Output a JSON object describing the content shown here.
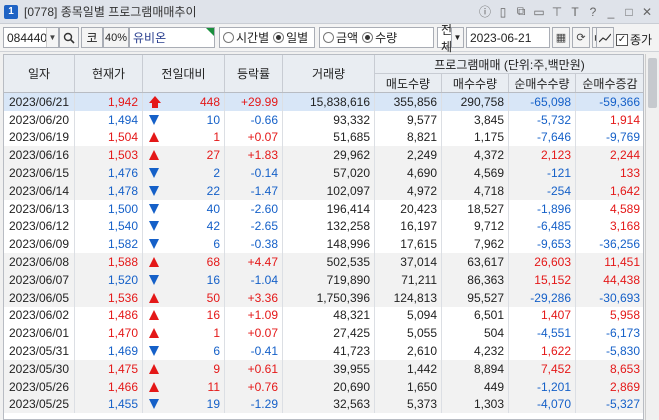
{
  "window": {
    "number": "1",
    "title": "[0778] 종목일별 프로그램매매추이"
  },
  "toolbar": {
    "code": "084440",
    "ko_label": "코",
    "pct_label": "40%",
    "stock_name": "유비온",
    "radio_time": "시간별",
    "radio_daily": "일별",
    "radio_amount": "금액",
    "radio_qty": "수량",
    "select_all": "전체",
    "date": "2023-06-21",
    "check_label": "종가"
  },
  "columns": {
    "date": "일자",
    "price": "현재가",
    "change": "전일대비",
    "rate": "등락률",
    "volume": "거래량",
    "group": "프로그램매매 (단위:주,백만원)",
    "sell": "매도수량",
    "buy": "매수수량",
    "net": "순매수수량",
    "net_inc": "순매수증감"
  },
  "rows": [
    {
      "date": "2023/06/21",
      "price": "1,942",
      "dir": "limit",
      "chg": "448",
      "rate": "+29.99",
      "vol": "15,838,616",
      "sell": "355,856",
      "buy": "290,758",
      "net": "-65,098",
      "inc": "-59,366"
    },
    {
      "date": "2023/06/20",
      "price": "1,494",
      "dir": "dn",
      "chg": "10",
      "rate": "-0.66",
      "vol": "93,332",
      "sell": "9,577",
      "buy": "3,845",
      "net": "-5,732",
      "inc": "1,914"
    },
    {
      "date": "2023/06/19",
      "price": "1,504",
      "dir": "up",
      "chg": "1",
      "rate": "+0.07",
      "vol": "51,685",
      "sell": "8,821",
      "buy": "1,175",
      "net": "-7,646",
      "inc": "-9,769"
    },
    {
      "date": "2023/06/16",
      "price": "1,503",
      "dir": "up",
      "chg": "27",
      "rate": "+1.83",
      "vol": "29,962",
      "sell": "2,249",
      "buy": "4,372",
      "net": "2,123",
      "inc": "2,244"
    },
    {
      "date": "2023/06/15",
      "price": "1,476",
      "dir": "dn",
      "chg": "2",
      "rate": "-0.14",
      "vol": "57,020",
      "sell": "4,690",
      "buy": "4,569",
      "net": "-121",
      "inc": "133"
    },
    {
      "date": "2023/06/14",
      "price": "1,478",
      "dir": "dn",
      "chg": "22",
      "rate": "-1.47",
      "vol": "102,097",
      "sell": "4,972",
      "buy": "4,718",
      "net": "-254",
      "inc": "1,642"
    },
    {
      "date": "2023/06/13",
      "price": "1,500",
      "dir": "dn",
      "chg": "40",
      "rate": "-2.60",
      "vol": "196,414",
      "sell": "20,423",
      "buy": "18,527",
      "net": "-1,896",
      "inc": "4,589"
    },
    {
      "date": "2023/06/12",
      "price": "1,540",
      "dir": "dn",
      "chg": "42",
      "rate": "-2.65",
      "vol": "132,258",
      "sell": "16,197",
      "buy": "9,712",
      "net": "-6,485",
      "inc": "3,168"
    },
    {
      "date": "2023/06/09",
      "price": "1,582",
      "dir": "dn",
      "chg": "6",
      "rate": "-0.38",
      "vol": "148,996",
      "sell": "17,615",
      "buy": "7,962",
      "net": "-9,653",
      "inc": "-36,256"
    },
    {
      "date": "2023/06/08",
      "price": "1,588",
      "dir": "up",
      "chg": "68",
      "rate": "+4.47",
      "vol": "502,535",
      "sell": "37,014",
      "buy": "63,617",
      "net": "26,603",
      "inc": "11,451"
    },
    {
      "date": "2023/06/07",
      "price": "1,520",
      "dir": "dn",
      "chg": "16",
      "rate": "-1.04",
      "vol": "719,890",
      "sell": "71,211",
      "buy": "86,363",
      "net": "15,152",
      "inc": "44,438"
    },
    {
      "date": "2023/06/05",
      "price": "1,536",
      "dir": "up",
      "chg": "50",
      "rate": "+3.36",
      "vol": "1,750,396",
      "sell": "124,813",
      "buy": "95,527",
      "net": "-29,286",
      "inc": "-30,693"
    },
    {
      "date": "2023/06/02",
      "price": "1,486",
      "dir": "up",
      "chg": "16",
      "rate": "+1.09",
      "vol": "48,321",
      "sell": "5,094",
      "buy": "6,501",
      "net": "1,407",
      "inc": "5,958"
    },
    {
      "date": "2023/06/01",
      "price": "1,470",
      "dir": "up",
      "chg": "1",
      "rate": "+0.07",
      "vol": "27,425",
      "sell": "5,055",
      "buy": "504",
      "net": "-4,551",
      "inc": "-6,173"
    },
    {
      "date": "2023/05/31",
      "price": "1,469",
      "dir": "dn",
      "chg": "6",
      "rate": "-0.41",
      "vol": "41,723",
      "sell": "2,610",
      "buy": "4,232",
      "net": "1,622",
      "inc": "-5,830"
    },
    {
      "date": "2023/05/30",
      "price": "1,475",
      "dir": "up",
      "chg": "9",
      "rate": "+0.61",
      "vol": "39,955",
      "sell": "1,442",
      "buy": "8,894",
      "net": "7,452",
      "inc": "8,653"
    },
    {
      "date": "2023/05/26",
      "price": "1,466",
      "dir": "up",
      "chg": "11",
      "rate": "+0.76",
      "vol": "20,690",
      "sell": "1,650",
      "buy": "449",
      "net": "-1,201",
      "inc": "2,869"
    },
    {
      "date": "2023/05/25",
      "price": "1,455",
      "dir": "dn",
      "chg": "19",
      "rate": "-1.29",
      "vol": "32,563",
      "sell": "5,373",
      "buy": "1,303",
      "net": "-4,070",
      "inc": "-5,327"
    }
  ],
  "colors": {
    "up": "#e41818",
    "down": "#1560c8",
    "selected_row": "#d8e6f7"
  }
}
